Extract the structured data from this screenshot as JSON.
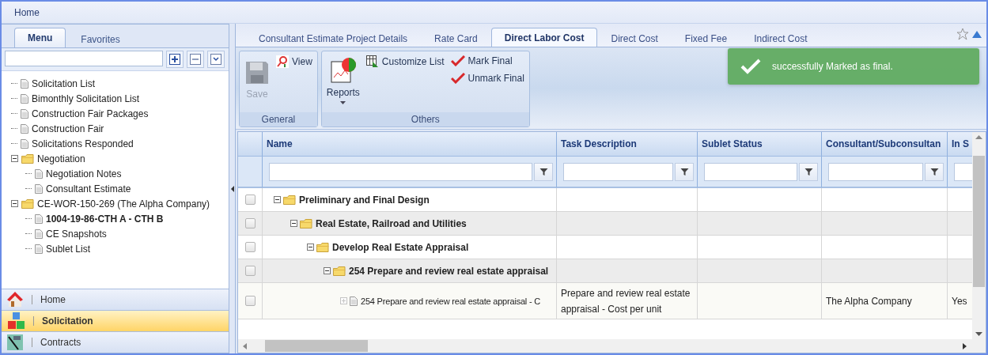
{
  "top_bar": {
    "title": "Home"
  },
  "sidebar": {
    "tabs": [
      {
        "label": "Menu",
        "selected": true
      },
      {
        "label": "Favorites",
        "selected": false
      }
    ],
    "tree": [
      {
        "label": "Solicitation List",
        "kind": "page",
        "selected": false
      },
      {
        "label": "Bimonthly Solicitation List",
        "kind": "page",
        "selected": false
      },
      {
        "label": "Construction Fair Packages",
        "kind": "page",
        "selected": false
      },
      {
        "label": "Construction Fair",
        "kind": "page",
        "selected": false
      },
      {
        "label": "Solicitations Responded",
        "kind": "page",
        "selected": false
      },
      {
        "label": "Negotiation",
        "kind": "folder",
        "expanded": true,
        "selected": false,
        "children": [
          {
            "label": "Negotiation Notes",
            "kind": "page",
            "selected": false
          },
          {
            "label": "Consultant Estimate",
            "kind": "page",
            "selected": false
          }
        ]
      },
      {
        "label": "CE-WOR-150-269 (The Alpha Company)",
        "kind": "folder",
        "expanded": true,
        "selected": false,
        "children": [
          {
            "label": "1004-19-86-CTH A - CTH B",
            "kind": "page",
            "selected": true
          },
          {
            "label": "CE Snapshots",
            "kind": "page",
            "selected": false
          },
          {
            "label": "Sublet List",
            "kind": "page",
            "selected": false
          }
        ]
      }
    ],
    "nav": [
      {
        "label": "Home",
        "kind": "home",
        "selected": false
      },
      {
        "label": "Solicitation",
        "kind": "blocks",
        "selected": true
      },
      {
        "label": "Contracts",
        "kind": "contracts",
        "selected": false
      }
    ]
  },
  "main": {
    "tabs": [
      {
        "label": "Consultant Estimate Project Details",
        "selected": false
      },
      {
        "label": "Rate Card",
        "selected": false
      },
      {
        "label": "Direct Labor Cost",
        "selected": true
      },
      {
        "label": "Direct Cost",
        "selected": false
      },
      {
        "label": "Fixed Fee",
        "selected": false
      },
      {
        "label": "Indirect Cost",
        "selected": false
      }
    ],
    "ribbon": [
      {
        "title": "General",
        "buttons": [
          {
            "label": "Save",
            "kind": "save",
            "disabled": true,
            "dropdown": false
          },
          {
            "label": "View",
            "kind": "view",
            "disabled": false,
            "dropdown": false
          }
        ]
      },
      {
        "title": "Others",
        "buttons": [
          {
            "label": "Reports",
            "kind": "reports",
            "disabled": false,
            "dropdown": true
          },
          {
            "label": "Customize List",
            "kind": "customize",
            "disabled": false,
            "dropdown": false
          },
          {
            "label": "Mark Final",
            "kind": "check",
            "disabled": false,
            "dropdown": false
          },
          {
            "label": "Unmark Final",
            "kind": "check",
            "disabled": false,
            "dropdown": false
          }
        ]
      }
    ],
    "toast": {
      "message": "successfully Marked as final."
    },
    "grid": {
      "columns": [
        {
          "label": "Name",
          "filter_button": true
        },
        {
          "label": "Task Description",
          "filter_button": true
        },
        {
          "label": "Sublet Status",
          "filter_button": true
        },
        {
          "label": "Consultant/Subconsultan",
          "filter_button": true
        },
        {
          "label": "In S",
          "filter_button": false
        }
      ],
      "rows": [
        {
          "name": "Preliminary and Final Design",
          "kind": "folder",
          "expanded": true,
          "checked": false,
          "children": [
            {
              "name": "Real Estate, Railroad and Utilities",
              "kind": "folder",
              "expanded": true,
              "checked": false,
              "children": [
                {
                  "name": "Develop Real Estate Appraisal",
                  "kind": "folder",
                  "expanded": true,
                  "checked": false,
                  "children": [
                    {
                      "name": "254 Prepare and review real estate appraisal",
                      "kind": "folder",
                      "expanded": true,
                      "checked": false,
                      "children": [
                        {
                          "name": "254 Prepare and review real estate appraisal - C",
                          "kind": "item",
                          "expanded": false,
                          "checked": false,
                          "task_description": "Prepare and review real estate appraisal - Cost per unit",
                          "consultant": "The Alpha Company",
                          "in_scope": "Yes"
                        }
                      ]
                    }
                  ]
                }
              ]
            }
          ]
        }
      ]
    }
  }
}
